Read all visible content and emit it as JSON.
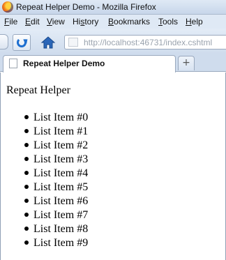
{
  "window": {
    "title": "Repeat Helper Demo - Mozilla Firefox"
  },
  "menu": {
    "items": [
      {
        "key": "F",
        "rest": "ile"
      },
      {
        "key": "E",
        "rest": "dit"
      },
      {
        "key": "V",
        "rest": "iew"
      },
      {
        "key": "",
        "rest": "Hi",
        "key2": "s",
        "rest2": "tory"
      },
      {
        "key": "B",
        "rest": "ookmarks"
      },
      {
        "key": "T",
        "rest": "ools"
      },
      {
        "key": "H",
        "rest": "elp"
      }
    ]
  },
  "nav": {
    "url": "http://localhost:46731/index.cshtml"
  },
  "tabs": {
    "active_title": "Repeat Helper Demo",
    "new_tab_glyph": "+"
  },
  "page": {
    "heading": "Repeat Helper",
    "items": [
      "List Item #0",
      "List Item #1",
      "List Item #2",
      "List Item #3",
      "List Item #4",
      "List Item #5",
      "List Item #6",
      "List Item #7",
      "List Item #8",
      "List Item #9"
    ]
  }
}
